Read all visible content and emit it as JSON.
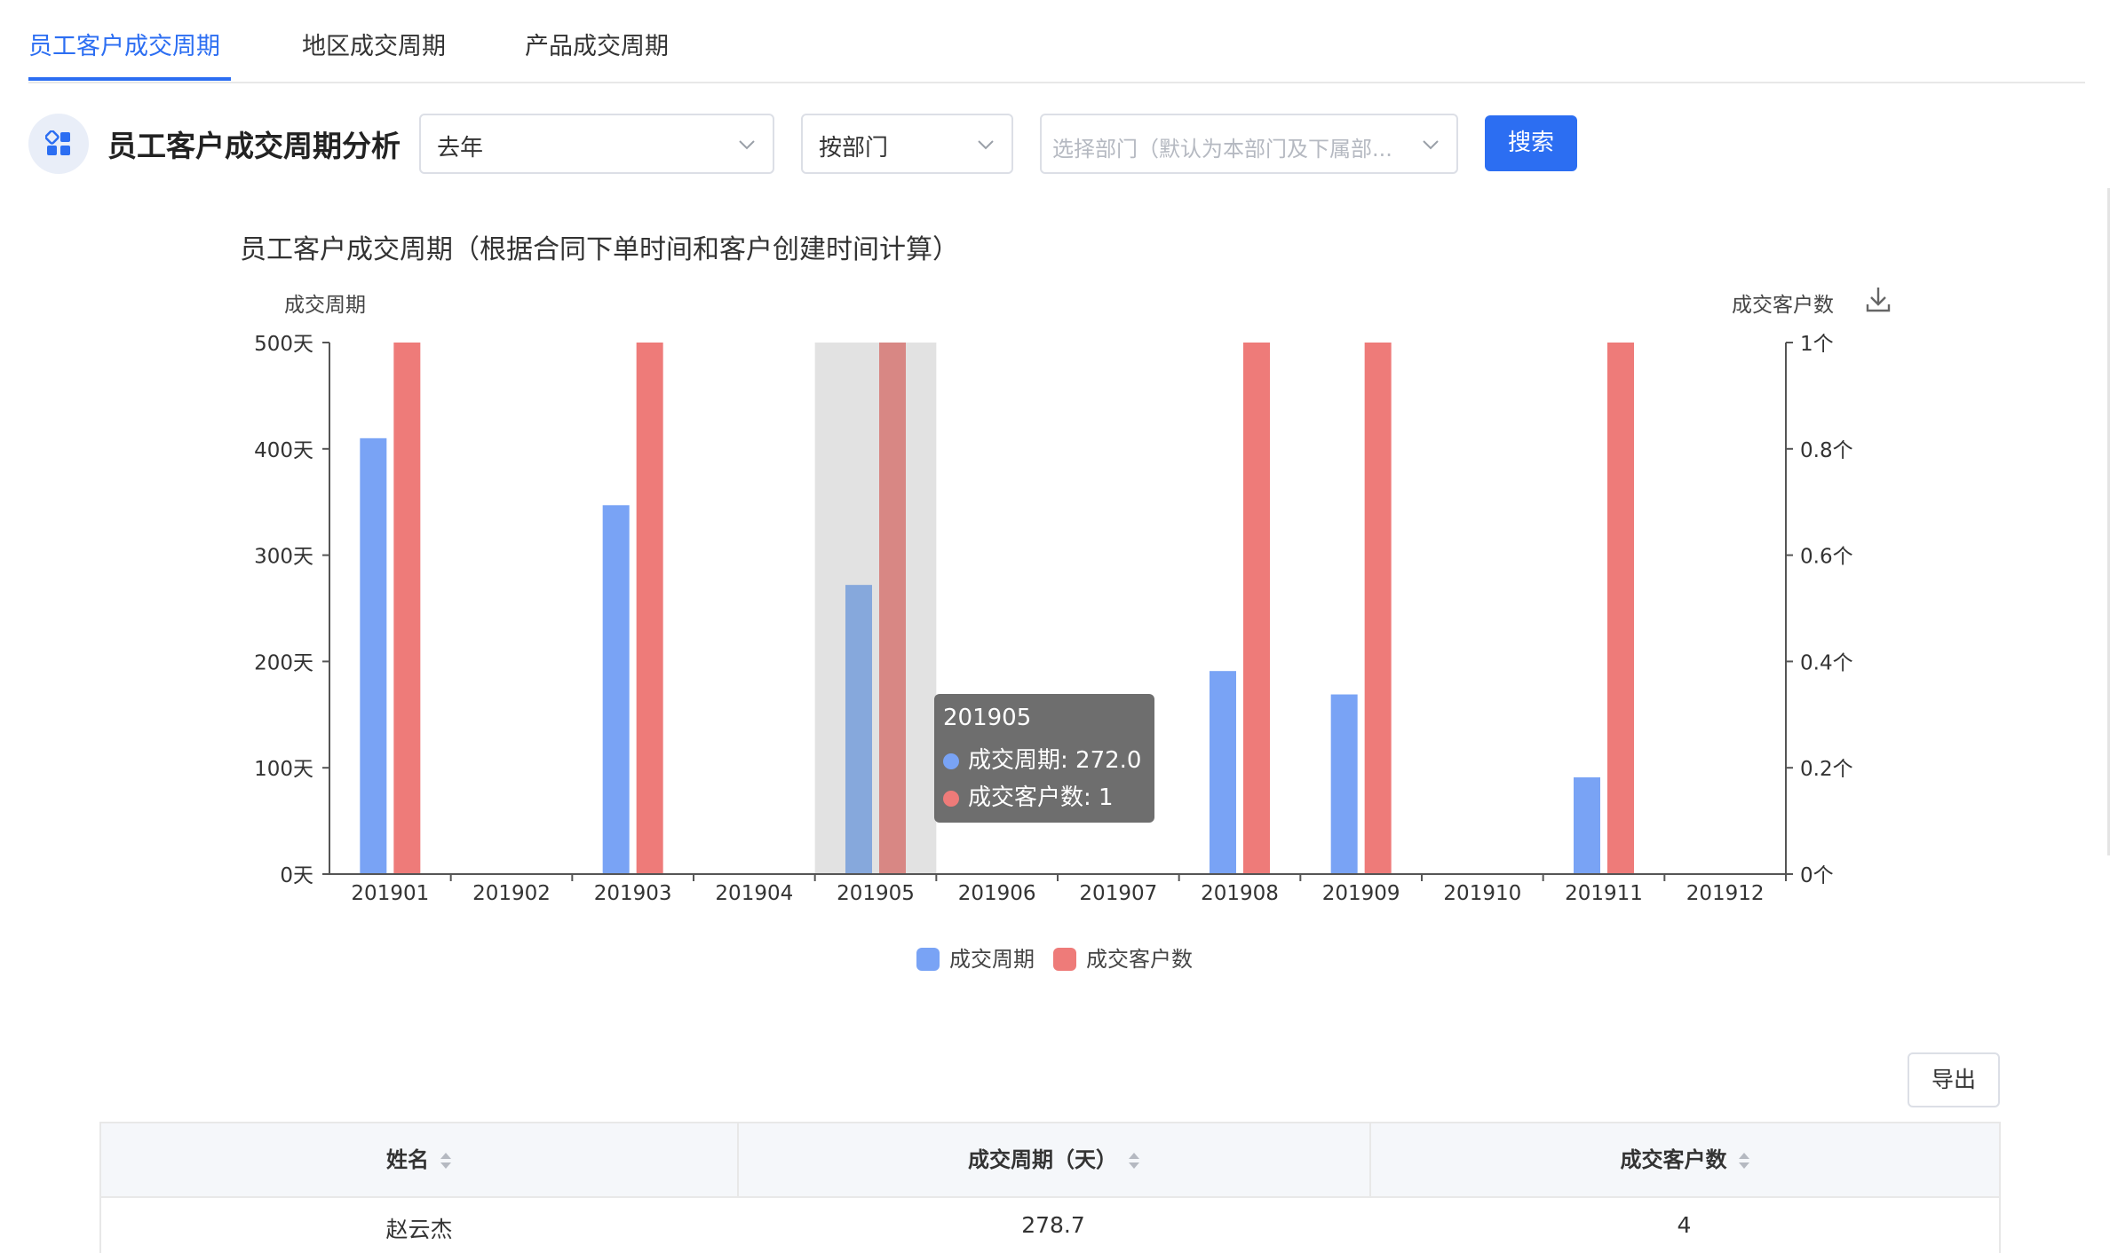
{
  "tabs": [
    {
      "label": "员工客户成交周期",
      "active": true
    },
    {
      "label": "地区成交周期",
      "active": false
    },
    {
      "label": "产品成交周期",
      "active": false
    }
  ],
  "toolbar": {
    "title": "员工客户成交周期分析",
    "period_value": "去年",
    "group_value": "按部门",
    "dept_placeholder": "选择部门（默认为本部门及下属部...",
    "search_label": "搜索"
  },
  "chart_title": "员工客户成交周期（根据合同下单时间和客户创建时间计算）",
  "tooltip": {
    "title": "201905",
    "line1": "成交周期: 272.0",
    "line2": "成交客户数: 1"
  },
  "export_label": "导出",
  "table": {
    "headers": [
      "姓名",
      "成交周期（天）",
      "成交客户数"
    ],
    "rows": [
      [
        "赵云杰",
        "278.7",
        "4"
      ]
    ]
  },
  "colors": {
    "primary": "#2c6ef2",
    "cycle": "#79a3f5",
    "customers": "#ee7b79"
  },
  "icons": [
    "apps-icon",
    "chevron-down-icon",
    "download-icon",
    "sort-icon"
  ],
  "chart_data": {
    "type": "bar",
    "categories": [
      "201901",
      "201902",
      "201903",
      "201904",
      "201905",
      "201906",
      "201907",
      "201908",
      "201909",
      "201910",
      "201911",
      "201912"
    ],
    "series": [
      {
        "name": "成交周期",
        "axis": "left",
        "values": [
          410,
          0,
          347,
          0,
          272,
          0,
          0,
          191,
          169,
          0,
          91,
          0
        ]
      },
      {
        "name": "成交客户数",
        "axis": "right",
        "values": [
          1,
          0,
          1,
          0,
          1,
          0,
          0,
          1,
          1,
          0,
          1,
          0
        ]
      }
    ],
    "y_left": {
      "label": "成交周期",
      "ticks": [
        "0天",
        "100天",
        "200天",
        "300天",
        "400天",
        "500天"
      ],
      "range": [
        0,
        500
      ]
    },
    "y_right": {
      "label": "成交客户数",
      "ticks": [
        "0个",
        "0.2个",
        "0.4个",
        "0.6个",
        "0.8个",
        "1个"
      ],
      "range": [
        0,
        1
      ]
    },
    "legend": [
      "成交周期",
      "成交客户数"
    ],
    "legend_position": "bottom-center",
    "highlighted_category": "201905"
  }
}
